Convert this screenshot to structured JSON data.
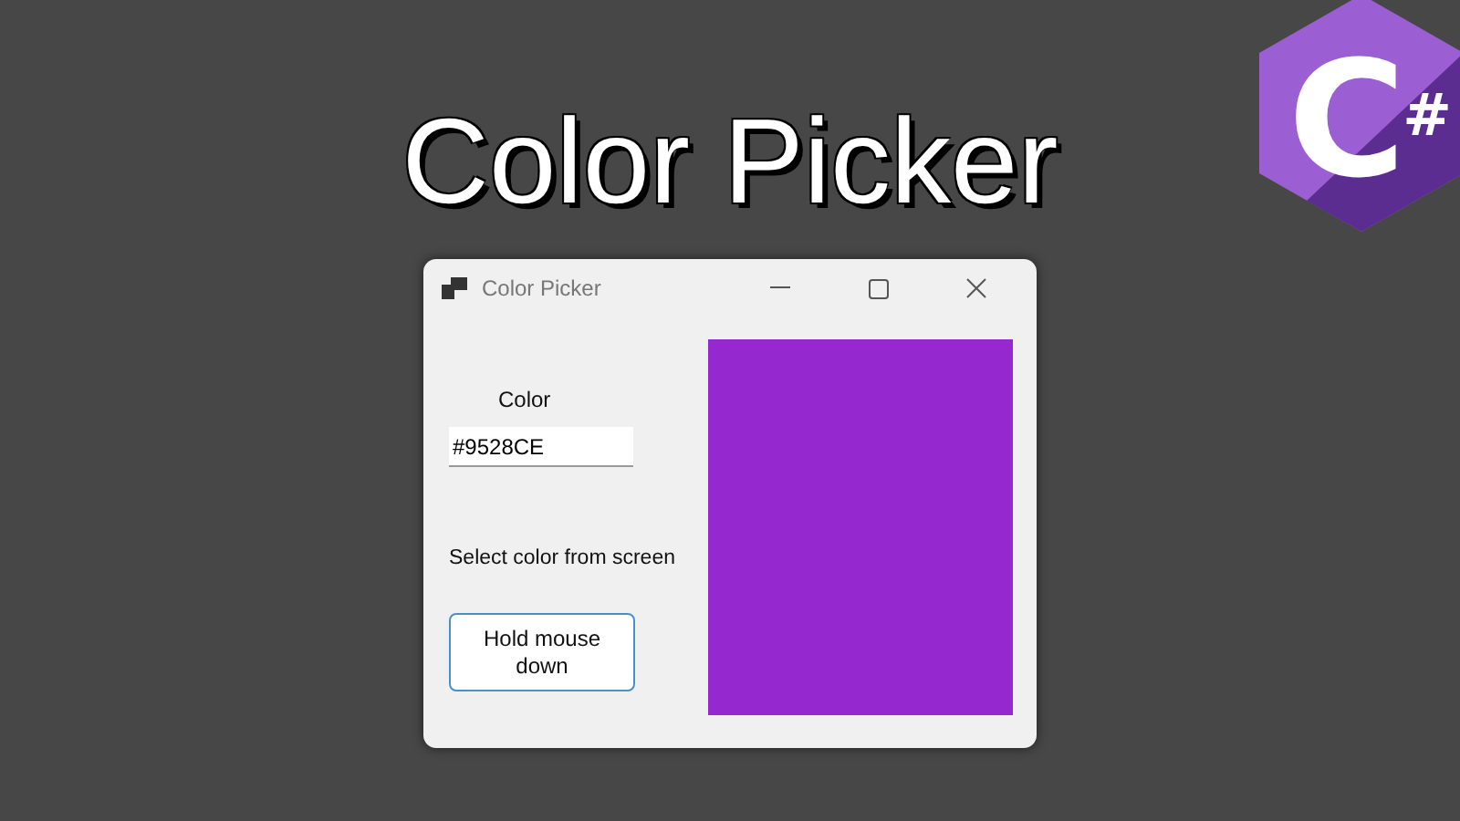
{
  "heading": "Color Picker",
  "logo": {
    "letter": "C",
    "mark": "#"
  },
  "window": {
    "title": "Color Picker",
    "color_label": "Color",
    "color_field": {
      "value": "#9528CE"
    },
    "screen_label": "Select color from screen",
    "button": "Hold mouse down",
    "swatch": {
      "color": "#9528ce"
    }
  }
}
